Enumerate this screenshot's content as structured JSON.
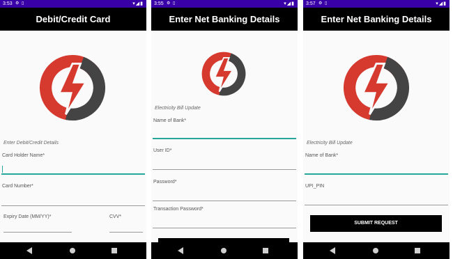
{
  "colors": {
    "status_bar": "#3a00a8",
    "app_bar": "#000000",
    "accent": "#26a69a",
    "logo_red": "#d63a2f",
    "logo_gray": "#444444"
  },
  "screens": [
    {
      "status_time": "3:53",
      "title": "Debit/Credit Card",
      "section_label": "Enter Debit/Credit Details",
      "fields": [
        {
          "label": "Card Holder Name*"
        },
        {
          "label": "Card Number*"
        },
        {
          "label": "Expiry Date (MM/YY)*"
        },
        {
          "label": "CVV*"
        }
      ]
    },
    {
      "status_time": "3:55",
      "title": "Enter Net Banking Details",
      "section_label": "Electricity Bill Update",
      "fields": [
        {
          "label": "Name of Bank*"
        },
        {
          "label": "User ID*"
        },
        {
          "label": "Password*"
        },
        {
          "label": "Transaction Password*"
        }
      ]
    },
    {
      "status_time": "3:57",
      "title": "Enter Net Banking Details",
      "section_label": "Electricity Bill Update",
      "fields": [
        {
          "label": "Name of Bank*"
        },
        {
          "label": "UPI_PIN"
        }
      ],
      "submit_label": "SUBMIT REQUEST"
    }
  ],
  "icons": {
    "status": "status-icons",
    "wifi": "wifi-icon",
    "battery": "battery-icon",
    "back": "back-icon",
    "home": "home-icon",
    "recent": "recent-apps-icon"
  }
}
